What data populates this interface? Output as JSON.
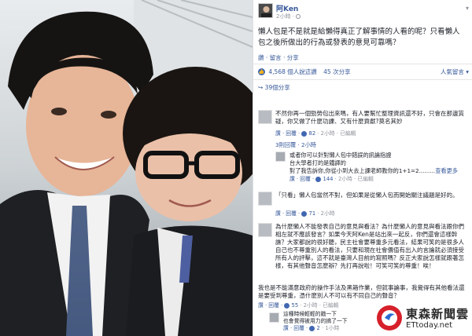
{
  "post": {
    "author": "阿Ken",
    "time": "2小時 ·",
    "body": "懶人包是不是就是給懶得真正了解事情的人看的呢？只看懶人包之後所做出的行為或發表的意見可靠嗎？",
    "actions": "讚 · 留言 · 分享",
    "likes": "4,568 個人說這讚",
    "shares": "45 次分享",
    "top_comments": "人氣留言 ▾",
    "shares_line": "39個分享"
  },
  "comments": [
    {
      "text": "不然你再一個勁勞包出來嗎，有人要幫忙整理資訊還不好，只會在那邊質疑，你又做了什麼功課、又有什麼貢獻?莫名其妙",
      "meta_a": "讚 · 回覆 · ",
      "likes": "82",
      "time": " · 2小時 · 已編輯"
    },
    {
      "text": "或者你可以針對懶人包中錯誤的訊論指證",
      "meta_a": "",
      "likes": "",
      "time": ""
    },
    {
      "text": "「只看」懶人包當然不對，但如果是從懶人包而開始關注議題是好的。",
      "meta_a": "讚 · 回覆 · ",
      "likes": "71",
      "time": " · 2小時"
    },
    {
      "text": "為什麼懶人不能發表自己的意見與看法？為什麼懶人的意見與看法跟你們相左就不應該發言？如果今天阿Ken是站出來一起反，你們還會這樣幹譙？大家都說的很好聽，民主社會要尊重多元看法，結果可笑的是很多人自己也不尊重別人的看法，只要和現在社會價值有出入的言論就必須接受所有人的評擊，這不就是臺灣人目前的寫照嗎？反正大家說怎樣就跟著怎樣，有其他聲音怎麼辦？先打再說啦！可笑可笑的尊重！唉！",
      "meta_a": "",
      "likes": "",
      "time": ""
    },
    {
      "text": "我也是不能滿意政府的操作手法及黑箱作業，但就事論事，我覺得有其他看法還是要受到尊重，憑什麼別人不可以有不同自己的聲音？",
      "meta_a": "讚 · 回覆 · ",
      "likes": "55",
      "time": " · 2小時 · 已編輯"
    }
  ],
  "first_meta": {
    "a": "讚 · 回覆 · ",
    "likes": "82",
    "b": " · 2小時 · 已編輯"
  },
  "replies_1": {
    "label": "3則回覆 · 2小時"
  },
  "reply_a": {
    "line1": "或者你可以針對懶人包中錯誤的訊論指證",
    "line2": "台大學者打的是鐵譯的",
    "line3": "對了我告訴你,你從小到大去上課老師教你的1+1=2.........",
    "see_more": "查看更多",
    "meta": "讚 · 回覆 · ",
    "likes": "144",
    "time": " · 2小時 · 已編輯"
  },
  "c3_meta": {
    "a": "讚 · 回覆 · ",
    "likes": "71",
    "b": " · 2小時"
  },
  "c5_meta": {
    "a": "讚 · 回覆 · ",
    "likes": "55",
    "b": " · 2小時 · 已編輯"
  },
  "reply_b": {
    "line1": "這種時候輕輕的戳一下",
    "line2": "也會覺得被用力的搞了一下",
    "meta": "讚 · 回覆 · ",
    "likes": "2",
    "time": " · 1小時"
  },
  "watermark": {
    "name": "東森新聞雲",
    "url": "ETtoday.net"
  },
  "colors": {
    "link": "#365899",
    "like_blue": "#4267b2",
    "brand_red": "#d6202a"
  }
}
